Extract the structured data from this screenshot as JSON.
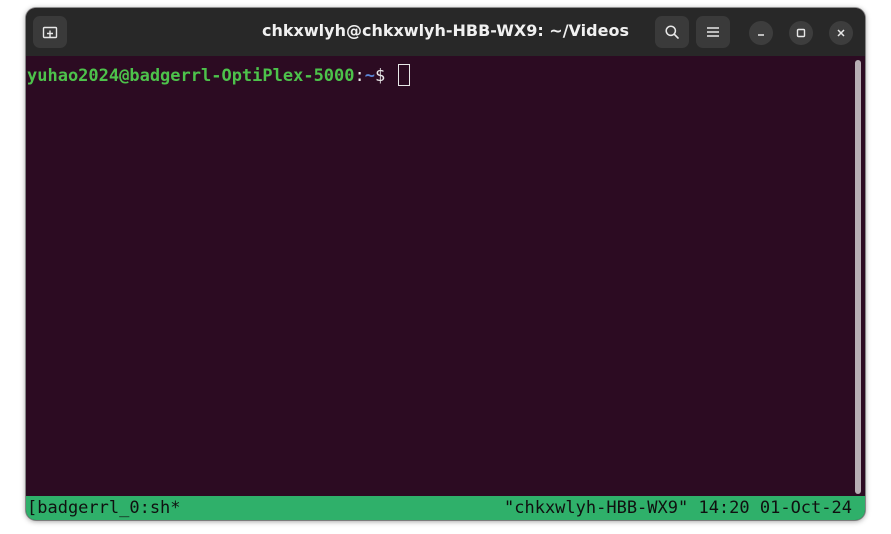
{
  "window": {
    "title": "chkxwlyh@chkxwlyh-HBB-WX9: ~/Videos"
  },
  "titlebar": {
    "icons": {
      "new_tab": "new-tab-icon",
      "search": "search-icon",
      "menu": "hamburger-menu-icon",
      "minimize": "minimize-icon",
      "maximize": "maximize-icon",
      "close": "close-icon"
    }
  },
  "terminal": {
    "prompt_user_host": "yuhao2024@badgerrl-OptiPlex-5000",
    "prompt_colon": ":",
    "prompt_path": "~",
    "prompt_symbol": "$ "
  },
  "tmux_status": {
    "left": "[badgerrl_0:sh*",
    "right": "\"chkxwlyh-HBB-WX9\" 14:20 01-Oct-24"
  },
  "colors": {
    "terminal_bg": "#2c0b22",
    "titlebar_bg": "#282828",
    "prompt_user": "#4dc24b",
    "prompt_path": "#5a86d6",
    "status_bar": "#2fb06a"
  }
}
